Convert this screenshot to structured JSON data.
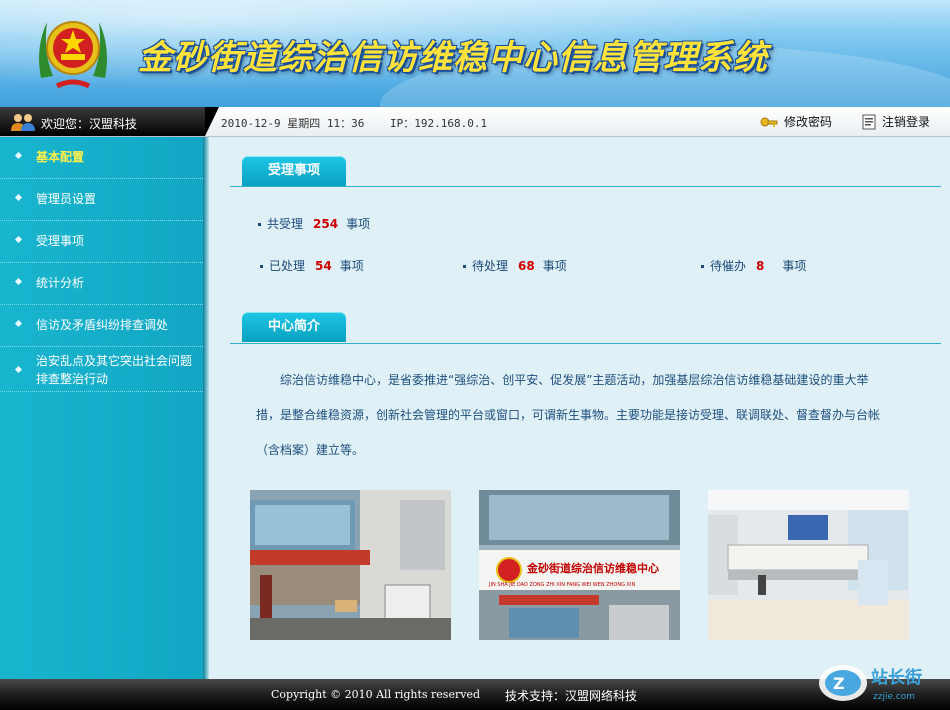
{
  "header": {
    "system_title": "金砂街道综治信访维稳中心信息管理系统"
  },
  "topbar": {
    "welcome": "欢迎您：汉盟科技",
    "datetime": "2010-12-9 星期四 11：36",
    "ip": "IP：192.168.0.1",
    "change_password": "修改密码",
    "logout": "注销登录"
  },
  "sidebar": {
    "items": [
      {
        "label": "基本配置",
        "active": true
      },
      {
        "label": "管理员设置"
      },
      {
        "label": "受理事项"
      },
      {
        "label": "统计分析"
      },
      {
        "label": "信访及矛盾纠纷排查调处"
      },
      {
        "label_line1": "治安乱点及其它突出社会问题",
        "label_line2": "排查整治行动"
      }
    ]
  },
  "main": {
    "section1_title": "受理事项",
    "total": {
      "prefix": "共受理",
      "count": "254",
      "suffix": "事项"
    },
    "processed": {
      "prefix": "已处理",
      "count": "54",
      "suffix": "事项"
    },
    "pending": {
      "prefix": "待处理",
      "count": "68",
      "suffix": "事项"
    },
    "urge": {
      "prefix": "待催办",
      "count": "8",
      "suffix": "事项"
    },
    "section2_title": "中心简介",
    "intro_line1": "综治信访维稳中心，是省委推进“强综治、创平安、促发展”主题活动，加强基层综治信访维稳基础建设的重大举",
    "intro_line2": "措，是整合维稳资源，创新社会管理的平台或窗口，可谓新生事物。主要功能是接访受理、联调联处、督查督办与台帐",
    "intro_line3": "（含档案）建立等。",
    "photo2_sign_cn": "金砂街道综治信访维稳中心",
    "photo2_sign_py": "JIN SHA JIE DAO ZONG ZHI XIN FANG WEI WEN ZHONG XIN"
  },
  "footer": {
    "copyright": "Copyright © 2010 All rights reserved",
    "support": "技术支持：汉盟网络科技"
  },
  "watermark": {
    "text": "站长街",
    "url_text": "zzjie.com"
  },
  "colors": {
    "accent": "#12a7c4",
    "highlight": "#d00000",
    "active_nav": "#fff04a"
  }
}
